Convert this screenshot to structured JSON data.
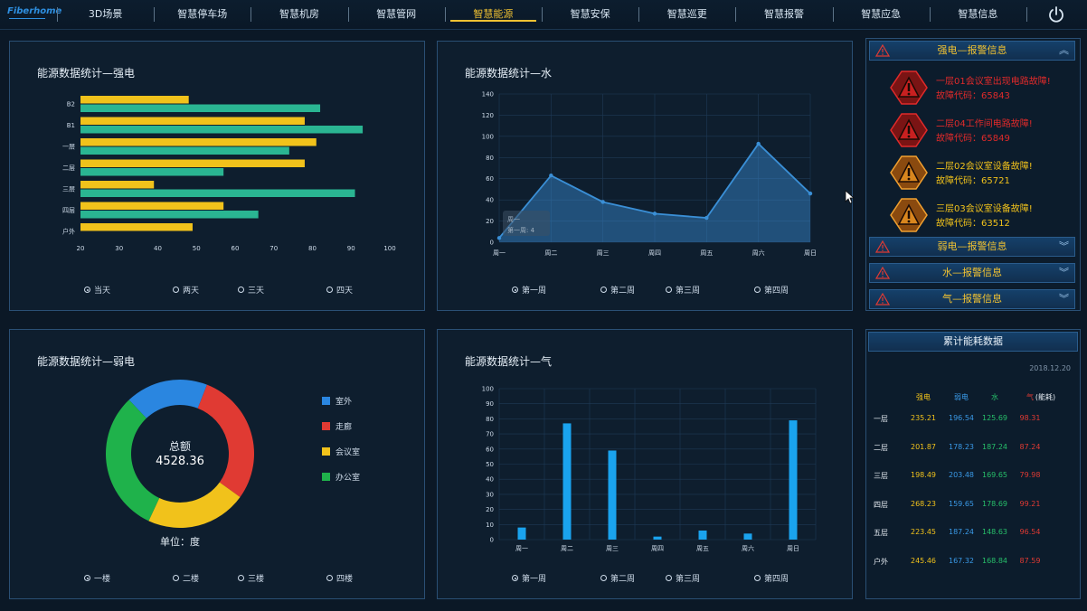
{
  "brand": {
    "logo_text": "Fiberhome"
  },
  "nav": [
    {
      "label": "3D场景"
    },
    {
      "label": "智慧停车场"
    },
    {
      "label": "智慧机房"
    },
    {
      "label": "智慧管网"
    },
    {
      "label": "智慧能源",
      "active": true
    },
    {
      "label": "智慧安保"
    },
    {
      "label": "智慧巡更"
    },
    {
      "label": "智慧报警"
    },
    {
      "label": "智慧应急"
    },
    {
      "label": "智慧信息"
    }
  ],
  "strong": {
    "title": "能源数据统计—强电",
    "radios": [
      "当天",
      "两天",
      "三天",
      "四天"
    ],
    "selected": 0,
    "chart_data": {
      "type": "bar",
      "orientation": "horizontal",
      "categories": [
        "B2",
        "B1",
        "一层",
        "二层",
        "三层",
        "四层",
        "户外"
      ],
      "series": [
        {
          "values": [
            48,
            78,
            81,
            78,
            39,
            57,
            49
          ],
          "color": "#f1c21b"
        },
        {
          "values": [
            82,
            93,
            74,
            57,
            91,
            66,
            null
          ],
          "color": "#2ab592"
        }
      ],
      "xlim": [
        20,
        100
      ],
      "xticks": [
        "20",
        "30",
        "40",
        "50",
        "60",
        "70",
        "80",
        "90",
        "100"
      ]
    }
  },
  "water": {
    "title": "能源数据统计—水",
    "radios": [
      "第一周",
      "第二周",
      "第三周",
      "第四周"
    ],
    "selected": 0,
    "tooltip": {
      "line1": "周一",
      "line2": "第一周: 4"
    },
    "chart_data": {
      "type": "area",
      "categories": [
        "周一",
        "周二",
        "周三",
        "周四",
        "周五",
        "周六",
        "周日"
      ],
      "values": [
        4,
        63,
        38,
        27,
        23,
        93,
        46
      ],
      "ylim": [
        0,
        140
      ],
      "yticks": [
        "0",
        "20",
        "40",
        "60",
        "80",
        "100",
        "120",
        "140"
      ],
      "color": "#3a8fd6"
    }
  },
  "weak": {
    "title": "能源数据统计—弱电",
    "radios": [
      "一楼",
      "二楼",
      "三楼",
      "四楼"
    ],
    "selected": 0,
    "center_label": "总额",
    "center_value": "4528.36",
    "unit": "单位：度",
    "chart_data": {
      "type": "pie",
      "labels": [
        "室外",
        "走廊",
        "会议室",
        "办公室"
      ],
      "values": [
        18,
        29,
        22,
        31
      ],
      "colors": [
        "#2a86e0",
        "#e03a33",
        "#f1c21b",
        "#1fb24b"
      ]
    }
  },
  "gas": {
    "title": "能源数据统计—气",
    "radios": [
      "第一周",
      "第二周",
      "第三周",
      "第四周"
    ],
    "selected": 0,
    "chart_data": {
      "type": "bar",
      "categories": [
        "周一",
        "周二",
        "周三",
        "周四",
        "周五",
        "周六",
        "周日"
      ],
      "values": [
        8,
        77,
        59,
        2,
        6,
        4,
        79
      ],
      "ylim": [
        0,
        100
      ],
      "yticks": [
        "0",
        "10",
        "20",
        "30",
        "40",
        "50",
        "60",
        "70",
        "80",
        "90",
        "100"
      ],
      "color": "#1aa3ee"
    }
  },
  "alarms": {
    "strong_header": "强电—报警信息",
    "items": [
      {
        "msg": "一层01会议室出现电路故障!",
        "code": "故障代码：65843",
        "level": "red",
        "color": "#e02a2a"
      },
      {
        "msg": "二层04工作间电路故障!",
        "code": "故障代码：65849",
        "level": "red",
        "color": "#e02a2a"
      },
      {
        "msg": "二层02会议室设备故障!",
        "code": "故障代码：65721",
        "level": "orange",
        "color": "#f1c21b"
      },
      {
        "msg": "三层03会议室设备故障!",
        "code": "故障代码：63512",
        "level": "orange",
        "color": "#f1c21b"
      }
    ],
    "other_headers": [
      "弱电—报警信息",
      "水—报警信息",
      "气—报警信息"
    ]
  },
  "cumulative": {
    "title": "累计能耗数据",
    "date": "2018.12.20",
    "columns": [
      "强电",
      "弱电",
      "水",
      "气",
      "(能耗)"
    ],
    "column_colors": [
      "#f1c21b",
      "#3a9ae8",
      "#27c06a",
      "#e03a33",
      "#e8eef4"
    ],
    "rows": [
      {
        "name": "一层",
        "values": [
          "235.21",
          "196.54",
          "125.69",
          "98.31"
        ]
      },
      {
        "name": "二层",
        "values": [
          "201.87",
          "178.23",
          "187.24",
          "87.24"
        ]
      },
      {
        "name": "三层",
        "values": [
          "198.49",
          "203.48",
          "169.65",
          "79.98"
        ]
      },
      {
        "name": "四层",
        "values": [
          "268.23",
          "159.65",
          "178.69",
          "99.21"
        ]
      },
      {
        "name": "五层",
        "values": [
          "223.45",
          "187.24",
          "148.63",
          "96.54"
        ]
      },
      {
        "name": "户外",
        "values": [
          "245.46",
          "167.32",
          "168.84",
          "87.59"
        ]
      }
    ]
  }
}
